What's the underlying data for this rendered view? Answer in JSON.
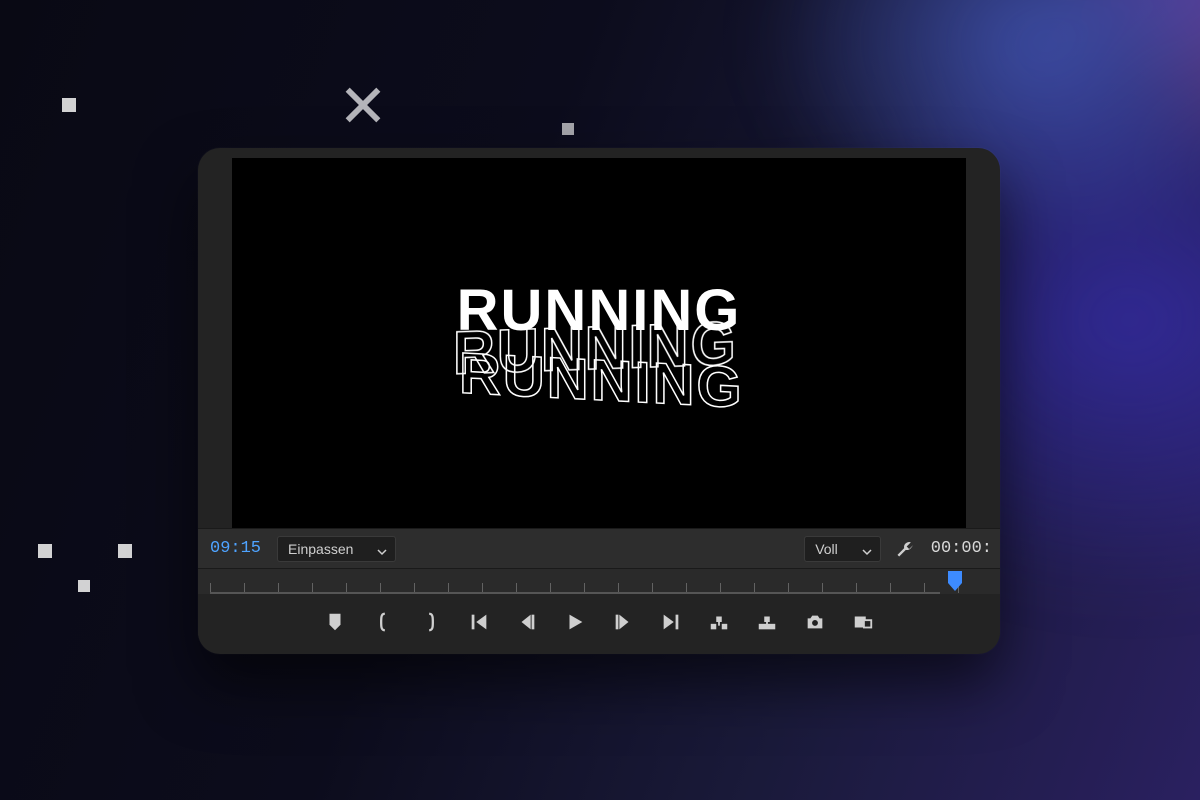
{
  "background": {
    "decorative_cross_icon": "close-icon"
  },
  "preview": {
    "title_text": "RUNNING",
    "title_outline_1": "RUNNING",
    "title_outline_2": "RUNNING"
  },
  "controls": {
    "timecode_left": "09:15",
    "zoom_dropdown_label": "Einpassen",
    "resolution_dropdown_label": "Voll",
    "timecode_right": "00:00:"
  },
  "transport": {
    "add_marker_icon": "marker-icon",
    "mark_in_icon": "brace-open-icon",
    "mark_out_icon": "brace-close-icon",
    "go_to_in_icon": "go-to-in-icon",
    "step_back_icon": "step-back-icon",
    "play_icon": "play-icon",
    "step_forward_icon": "step-forward-icon",
    "go_to_out_icon": "go-to-out-icon",
    "insert_icon": "insert-icon",
    "overwrite_icon": "overwrite-icon",
    "export_frame_icon": "camera-icon",
    "comparison_view_icon": "comparison-icon"
  },
  "colors": {
    "accent_blue": "#3d8bff",
    "panel_bg": "#232323",
    "control_bg": "#2d2d2d"
  }
}
